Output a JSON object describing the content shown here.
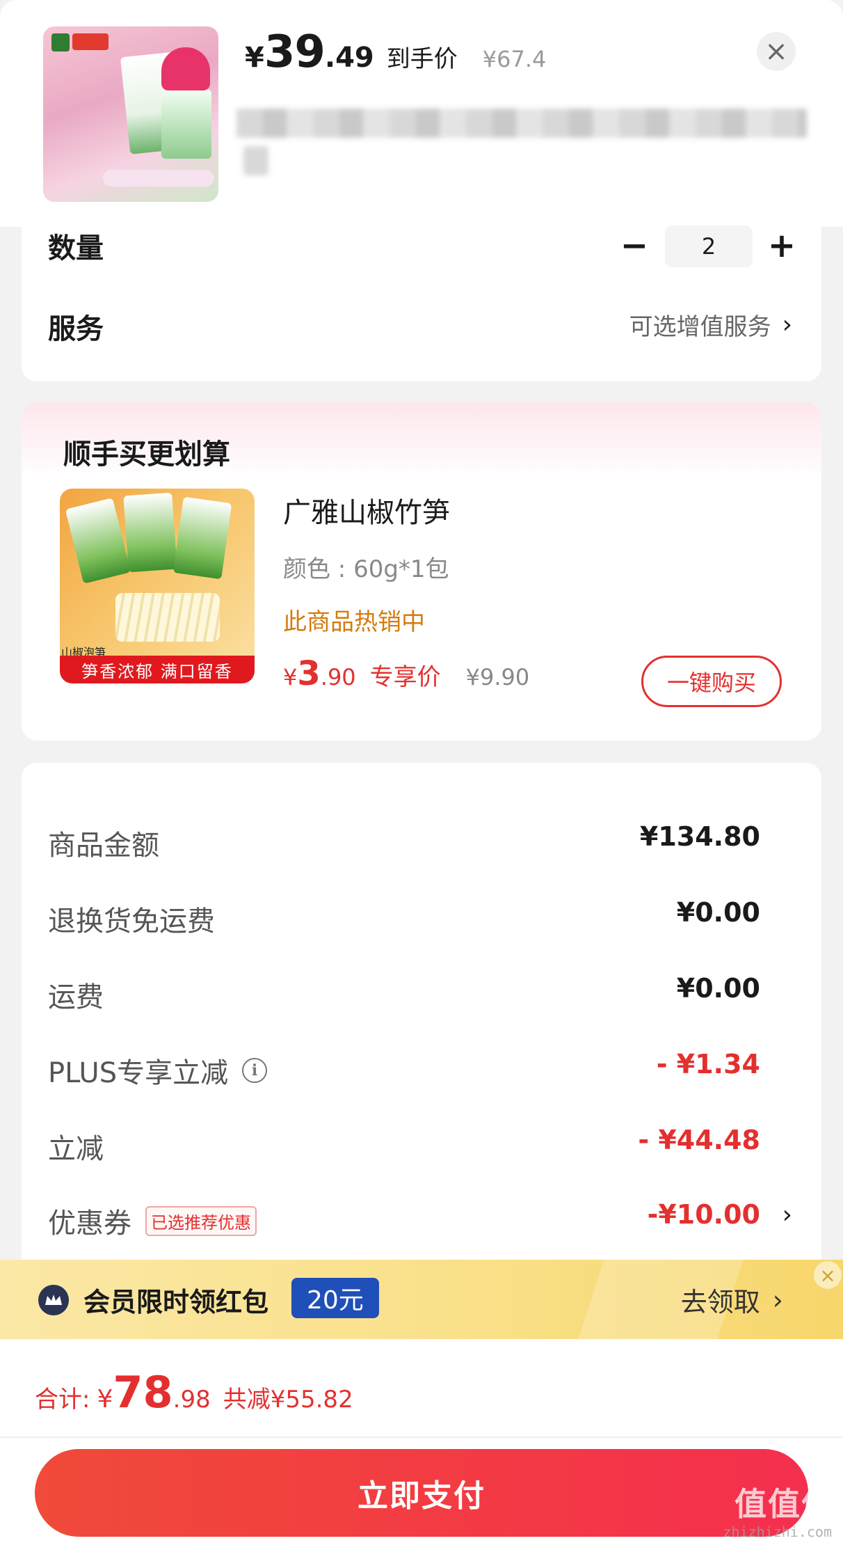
{
  "header": {
    "price_yen": "¥",
    "price_int": "39",
    "price_dec": ".49",
    "price_tag": "到手价",
    "orig_price": "¥67.4",
    "close_icon": "close-icon"
  },
  "card1": {
    "qty_label": "数量",
    "qty_minus": "−",
    "qty_value": "2",
    "qty_plus": "+",
    "service_label": "服务",
    "service_value": "可选增值服务",
    "service_chevron": "›"
  },
  "upsell": {
    "title": "顺手买更划算",
    "name": "广雅山椒竹笋",
    "spec": "颜色 : 60g*1包",
    "hot": "此商品热销中",
    "price_yen": "¥",
    "price_int": "3",
    "price_dec": ".90",
    "price_tag": "专享价",
    "orig_price": "¥9.90",
    "buy_label": "一键购买",
    "image_tag": "山椒泡笋",
    "image_banner": "笋香浓郁 满口留香"
  },
  "summary": {
    "rows": [
      {
        "label": "商品金额",
        "value": "¥134.80",
        "red": false
      },
      {
        "label": "退换货免运费",
        "value": "¥0.00",
        "red": false
      },
      {
        "label": "运费",
        "value": "¥0.00",
        "red": false
      },
      {
        "label": "PLUS专享立减",
        "value": "- ¥1.34",
        "red": true
      },
      {
        "label": "立减",
        "value": "- ¥44.48",
        "red": true
      },
      {
        "label": "优惠券",
        "value": "-¥10.00",
        "red": true
      }
    ],
    "coupon_tag": "已选推荐优惠",
    "info_icon": "i",
    "coupon_chevron": "›"
  },
  "member": {
    "text": "会员限时领红包",
    "badge": "20元",
    "action": "去领取",
    "action_chevron": "›",
    "close": "×"
  },
  "footer": {
    "total_label": "合计:",
    "total_yen": "¥",
    "total_int": "78",
    "total_dec": ".98",
    "saved": "共减¥55.82",
    "pay_label": "立即支付",
    "watermark": "值值值",
    "watermark_sub": "zhizhizhi.com"
  },
  "colors": {
    "accent_red": "#e3302f",
    "hot_orange": "#d57b0e",
    "member_blue": "#1f4fb8",
    "pay_gradient_start": "#f04a3a",
    "pay_gradient_end": "#f42f4f"
  }
}
